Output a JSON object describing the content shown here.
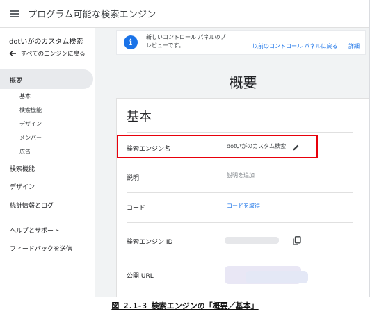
{
  "app": {
    "title": "プログラム可能な検索エンジン"
  },
  "sidebar": {
    "engine_name": "dotいがのカスタム検索",
    "back_label": "すべてのエンジンに戻る",
    "items": [
      {
        "label": "概要",
        "active": true
      },
      {
        "label": "検索機能"
      },
      {
        "label": "デザイン"
      },
      {
        "label": "統計情報とログ"
      },
      {
        "label": "ヘルプとサポート"
      },
      {
        "label": "フィードバックを送信"
      }
    ],
    "subitems": [
      {
        "label": "基本",
        "active": true
      },
      {
        "label": "検索機能"
      },
      {
        "label": "デザイン"
      },
      {
        "label": "メンバー"
      },
      {
        "label": "広告"
      }
    ]
  },
  "banner": {
    "text": "新しいコントロール パネルのプレビューです。",
    "link_old": "以前のコントロール パネルに戻る",
    "link_details": "詳細"
  },
  "page": {
    "title": "概要"
  },
  "card": {
    "title": "基本",
    "rows": [
      {
        "label": "検索エンジン名",
        "value": "dotいがのカスタム検索"
      },
      {
        "label": "説明",
        "value": "説明を追加"
      },
      {
        "label": "コード",
        "value": "コードを取得"
      },
      {
        "label": "検索エンジン ID",
        "value": ""
      },
      {
        "label": "公開 URL",
        "value": ""
      }
    ]
  },
  "caption": {
    "text": "図 2.1-3 検索エンジンの「概要／基本」"
  },
  "colors": {
    "accent": "#1a73e8",
    "highlight": "#e8000b",
    "background": "#f1f3f4"
  }
}
